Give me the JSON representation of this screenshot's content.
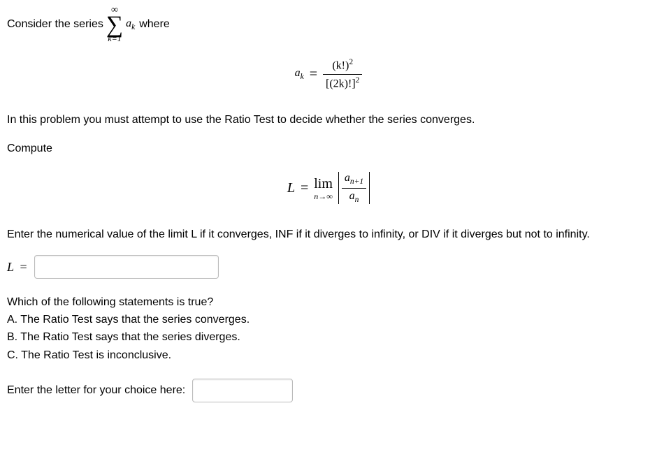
{
  "intro": {
    "t1": "Consider the series",
    "sum_upper": "∞",
    "sum_lower": "k=1",
    "term_var": "a",
    "term_sub": "k",
    "t2": "where"
  },
  "formula1": {
    "lhs_var": "a",
    "lhs_sub": "k",
    "eq": "=",
    "num": "(k!)",
    "num_exp": "2",
    "den": "[(2k)!]",
    "den_exp": "2"
  },
  "ratio_instr": "In this problem you must attempt to use the Ratio Test to decide whether the series converges.",
  "compute": "Compute",
  "formula2": {
    "L": "L",
    "eq": "=",
    "lim_top": "lim",
    "lim_bot": "n→∞",
    "num_a": "a",
    "num_sub": "n+1",
    "den_a": "a",
    "den_sub": "n"
  },
  "enter_limit": "Enter the numerical value of the limit L if it converges, INF if it diverges to infinity, or DIV if it diverges but not to infinity.",
  "L_label": "L",
  "eq_sign": "=",
  "mc": {
    "q": "Which of the following statements is true?",
    "a": "A. The Ratio Test says that the series converges.",
    "b": "B. The Ratio Test says that the series diverges.",
    "c": "C. The Ratio Test is inconclusive."
  },
  "choice_prompt": "Enter the letter for your choice here:"
}
